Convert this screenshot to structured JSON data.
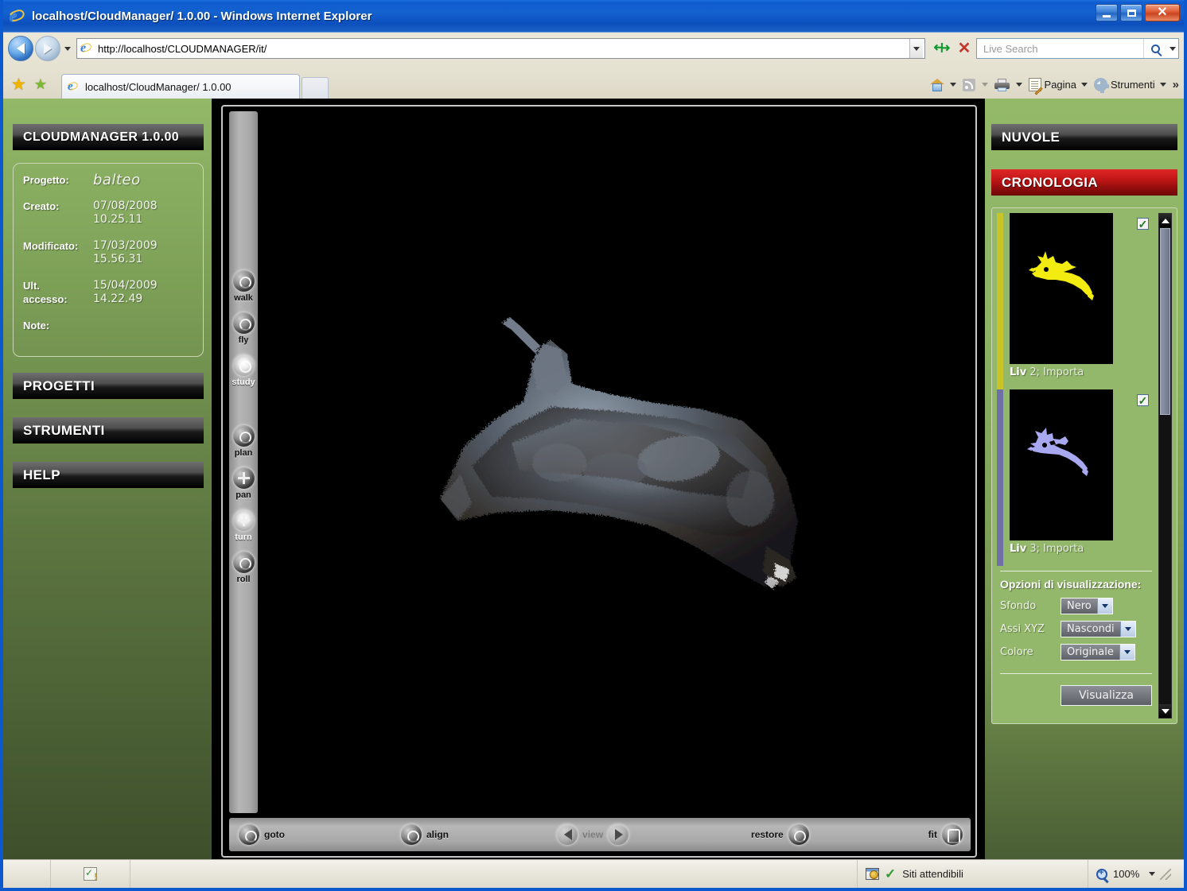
{
  "window": {
    "title": "localhost/CloudManager/ 1.0.00 - Windows Internet Explorer",
    "minimize_label": "Minimize",
    "maximize_label": "Maximize",
    "close_label": "Close"
  },
  "browser": {
    "back_label": "Back",
    "forward_label": "Forward",
    "url": "http://localhost/CLOUDMANAGER/it/",
    "refresh_label": "Refresh",
    "stop_label": "Stop",
    "search_placeholder": "Live Search",
    "favorites_label": "Favorites",
    "add_favorite_label": "Add to Favorites",
    "tab_title": "localhost/CloudManager/ 1.0.00",
    "new_tab_label": "New Tab",
    "commands": {
      "home": "Home",
      "feeds": "Feeds",
      "print": "Print",
      "page": "Pagina",
      "tools": "Strumenti",
      "more": "»"
    }
  },
  "sidebar": {
    "app_title": "CLOUDMANAGER 1.0.00",
    "project": {
      "fields": [
        {
          "label": "Progetto:",
          "value": "balteo",
          "italic": true
        },
        {
          "label": "Creato:",
          "value": "07/08/2008\n10.25.11"
        },
        {
          "label": "Modificato:",
          "value": "17/03/2009\n15.56.31"
        },
        {
          "label": "Ult.\naccesso:",
          "value": "15/04/2009\n14.22.49"
        },
        {
          "label": "Note:",
          "value": ""
        }
      ],
      "progetto_label": "Progetto:",
      "progetto_value": "balteo",
      "creato_label": "Creato:",
      "creato_value": "07/08/2008",
      "creato_value2": "10.25.11",
      "modificato_label": "Modificato:",
      "modificato_value": "17/03/2009",
      "modificato_value2": "15.56.31",
      "ult_label": "Ult.",
      "accesso_label": "accesso:",
      "accesso_value": "15/04/2009",
      "accesso_value2": "14.22.49",
      "note_label": "Note:",
      "note_value": ""
    },
    "menu": {
      "progetti": "PROGETTI",
      "strumenti": "STRUMENTI",
      "help": "HELP"
    }
  },
  "viewer": {
    "nav_tools": [
      {
        "name": "walk",
        "label": "walk",
        "active": false
      },
      {
        "name": "fly",
        "label": "fly",
        "active": false
      },
      {
        "name": "study",
        "label": "study",
        "active": true
      },
      {
        "name": "plan",
        "label": "plan",
        "active": false
      },
      {
        "name": "pan",
        "label": "pan",
        "active": false
      },
      {
        "name": "turn",
        "label": "turn",
        "active": true
      },
      {
        "name": "roll",
        "label": "roll",
        "active": false
      }
    ],
    "tool_walk": "walk",
    "tool_fly": "fly",
    "tool_study": "study",
    "tool_plan": "plan",
    "tool_pan": "pan",
    "tool_turn": "turn",
    "tool_roll": "roll",
    "bottom": {
      "goto": "goto",
      "align": "align",
      "view": "view",
      "restore": "restore",
      "fit": "fit"
    },
    "background_color": "#000000",
    "model_description": "3D scanned point cloud of a bronze balteo relief"
  },
  "right_panel": {
    "nuvole_label": "NUVOLE",
    "cronologia_label": "CRONOLOGIA",
    "cronologia_color": "#c01616",
    "layers": [
      {
        "prefix": "Liv",
        "number": "2;",
        "action": "Importa",
        "full_label": "Liv 2; Importa",
        "checked": true,
        "color": "#c9c427",
        "cloud_color": "#f2ec10"
      },
      {
        "prefix": "Liv",
        "number": "3;",
        "action": "Importa",
        "full_label": "Liv 3; Importa",
        "checked": true,
        "color": "#6f6fa8",
        "cloud_color": "#a8a8f0"
      }
    ],
    "options": {
      "title": "Opzioni di visualizzazione:",
      "rows": [
        {
          "label": "Sfondo",
          "value": "Nero"
        },
        {
          "label": "Assi XYZ",
          "value": "Nascondi"
        },
        {
          "label": "Colore",
          "value": "Originale"
        }
      ],
      "sfondo_label": "Sfondo",
      "sfondo_value": "Nero",
      "assi_label": "Assi XYZ",
      "assi_value": "Nascondi",
      "colore_label": "Colore",
      "colore_value": "Originale"
    },
    "visualizza_button": "Visualizza"
  },
  "statusbar": {
    "zone_label": "Siti attendibili",
    "zoom_level": "100%",
    "alert_label": "Errori pagina"
  }
}
